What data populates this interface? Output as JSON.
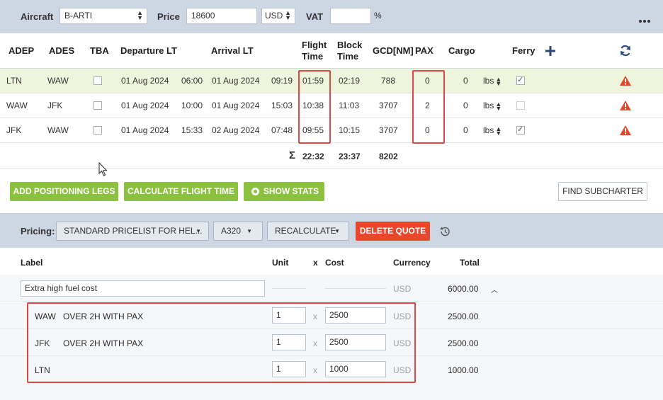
{
  "topbar": {
    "aircraft_label": "Aircraft",
    "aircraft_value": "B-ARTI",
    "price_label": "Price",
    "price_value": "18600",
    "currency_value": "USD",
    "vat_label": "VAT",
    "vat_value": "",
    "vat_unit": "%",
    "more_icon": "more-dots-icon"
  },
  "legs_table": {
    "headers": {
      "adep": "ADEP",
      "ades": "ADES",
      "tba": "TBA",
      "departure": "Departure LT",
      "arrival": "Arrival LT",
      "flight_time_1": "Flight",
      "flight_time_2": "Time",
      "block_time_1": "Block",
      "block_time_2": "Time",
      "gcd": "GCD[NM]",
      "pax": "PAX",
      "cargo": "Cargo",
      "ferry": "Ferry"
    },
    "rows": [
      {
        "adep": "LTN",
        "ades": "WAW",
        "tba": false,
        "dep_date": "01 Aug 2024",
        "dep_time": "06:00",
        "arr_date": "01 Aug 2024",
        "arr_time": "09:19",
        "flight_time": "01:59",
        "block_time": "02:19",
        "gcd": "788",
        "pax": "0",
        "cargo": "0",
        "cargo_unit": "lbs",
        "ferry": true
      },
      {
        "adep": "WAW",
        "ades": "JFK",
        "tba": false,
        "dep_date": "01 Aug 2024",
        "dep_time": "10:00",
        "arr_date": "01 Aug 2024",
        "arr_time": "15:03",
        "flight_time": "10:38",
        "block_time": "11:03",
        "gcd": "3707",
        "pax": "2",
        "cargo": "0",
        "cargo_unit": "lbs",
        "ferry": false
      },
      {
        "adep": "JFK",
        "ades": "WAW",
        "tba": false,
        "dep_date": "01 Aug 2024",
        "dep_time": "15:33",
        "arr_date": "02 Aug 2024",
        "arr_time": "07:48",
        "flight_time": "09:55",
        "block_time": "10:15",
        "gcd": "3707",
        "pax": "0",
        "cargo": "0",
        "cargo_unit": "lbs",
        "ferry": true
      }
    ],
    "totals": {
      "sigma": "Σ",
      "flight_time": "22:32",
      "block_time": "23:37",
      "gcd": "8202"
    }
  },
  "actions": {
    "add_positioning": "ADD POSITIONING LEGS",
    "calculate_flight_time": "CALCULATE FLIGHT TIME",
    "show_stats": "SHOW STATS",
    "find_subcharter": "FIND SUBCHARTER"
  },
  "pricing": {
    "label": "Pricing:",
    "pricelist": "STANDARD PRICELIST FOR HEL...",
    "aircraft_type": "A320",
    "recalculate": "RECALCULATE",
    "delete_quote": "DELETE QUOTE",
    "columns": {
      "label": "Label",
      "unit": "Unit",
      "x": "x",
      "cost": "Cost",
      "currency": "Currency",
      "total": "Total"
    },
    "items": [
      {
        "label": "Extra high fuel cost",
        "currency": "USD",
        "total": "6000.00"
      },
      {
        "airport": "WAW",
        "desc": "OVER 2H WITH PAX",
        "unit": "1",
        "x": "x",
        "cost": "2500",
        "currency": "USD",
        "total": "2500.00"
      },
      {
        "airport": "JFK",
        "desc": "OVER 2H WITH PAX",
        "unit": "1",
        "x": "x",
        "cost": "2500",
        "currency": "USD",
        "total": "2500.00"
      },
      {
        "airport": "LTN",
        "desc": "",
        "unit": "1",
        "x": "x",
        "cost": "1000",
        "currency": "USD",
        "total": "1000.00"
      }
    ]
  },
  "colors": {
    "accent_green": "#8cc13f",
    "danger_red": "#e9472b",
    "highlight_box": "#e04848",
    "warning": "#e2462b"
  }
}
